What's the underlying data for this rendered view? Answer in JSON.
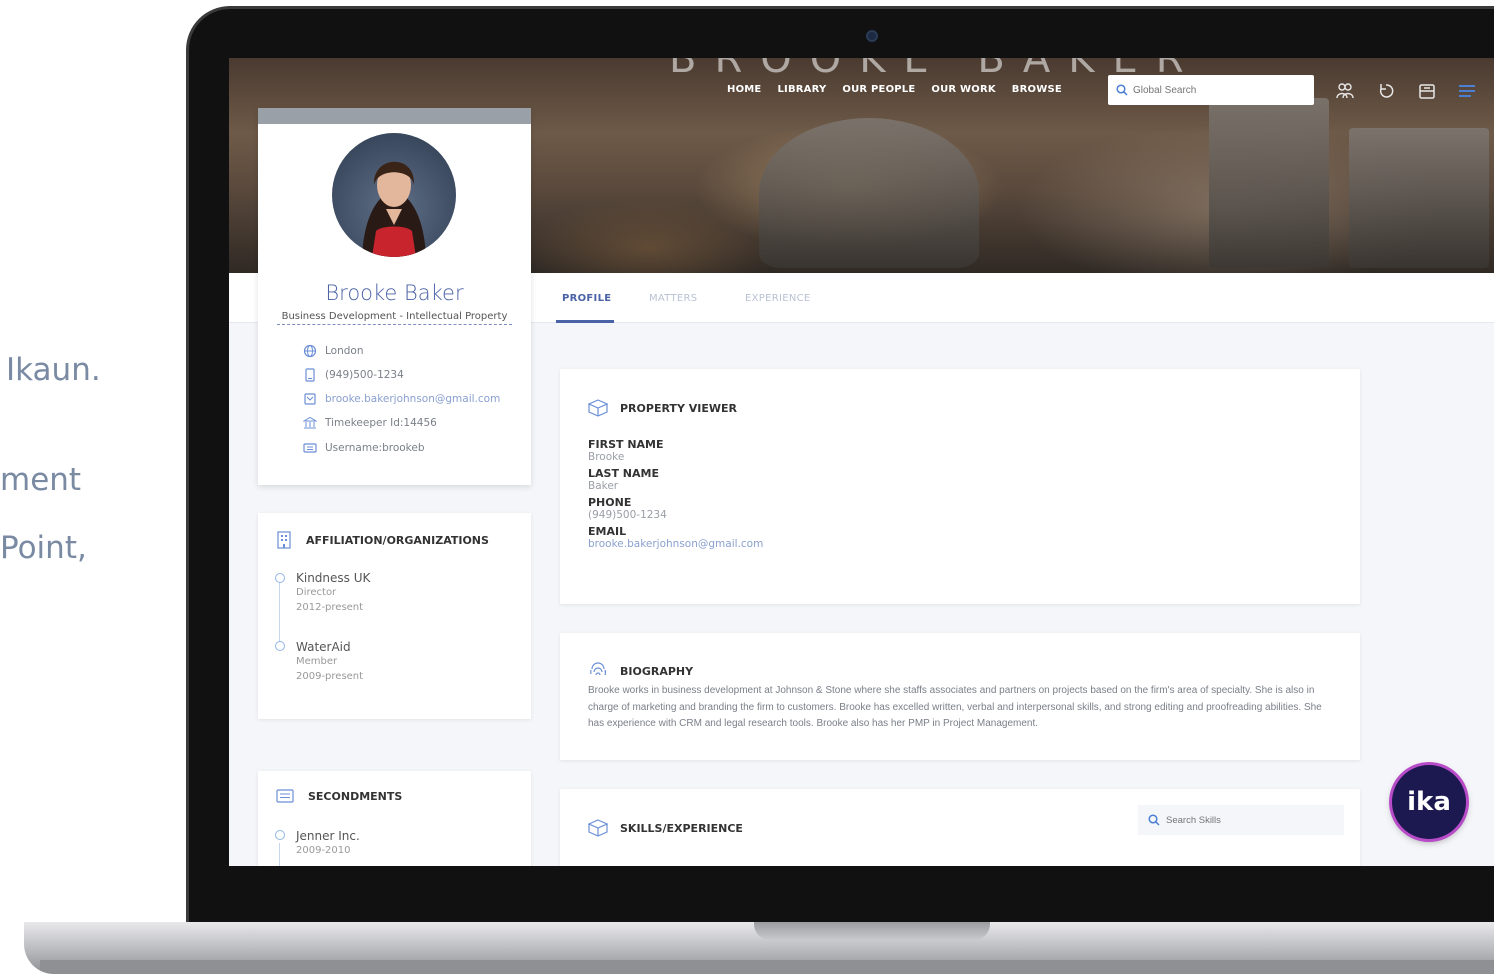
{
  "side_text": [
    "Ikaun.",
    "ment",
    "Point,"
  ],
  "hero": {
    "title": "BROOKE BAKER"
  },
  "nav": {
    "items": [
      "HOME",
      "LIBRARY",
      "OUR PEOPLE",
      "OUR WORK",
      "BROWSE"
    ]
  },
  "search": {
    "placeholder": "Global Search"
  },
  "header_icons": [
    "people-icon",
    "refresh-icon",
    "inbox-icon",
    "menu-icon"
  ],
  "profile": {
    "name": "Brooke Baker",
    "role": "Business Development - Intellectual Property",
    "location": "London",
    "phone": "(949)500-1234",
    "email": "brooke.bakerjohnson@gmail.com",
    "timekeeper": "Timekeeper Id:14456",
    "username": "Username:brookeb"
  },
  "affiliations": {
    "heading": "AFFILIATION/ORGANIZATIONS",
    "items": [
      {
        "name": "Kindness UK",
        "role": "Director",
        "period": "2012-present"
      },
      {
        "name": "WaterAid",
        "role": "Member",
        "period": "2009-present"
      }
    ]
  },
  "secondments": {
    "heading": "SECONDMENTS",
    "items": [
      {
        "name": "Jenner Inc.",
        "period": "2009-2010"
      }
    ]
  },
  "tabs": [
    {
      "label": "PROFILE",
      "active": true
    },
    {
      "label": "MATTERS",
      "active": false
    },
    {
      "label": "EXPERIENCE",
      "active": false
    }
  ],
  "property_viewer": {
    "heading": "PROPERTY VIEWER",
    "fields": [
      {
        "label": "FIRST NAME",
        "value": "Brooke"
      },
      {
        "label": "LAST NAME",
        "value": "Baker"
      },
      {
        "label": "PHONE",
        "value": "(949)500-1234"
      },
      {
        "label": "EMAIL",
        "value": "brooke.bakerjohnson@gmail.com"
      }
    ]
  },
  "biography": {
    "heading": "BIOGRAPHY",
    "text": "Brooke works in business development at Johnson & Stone where she staffs associates and partners on projects based on the firm's area of specialty. She is also in charge of marketing and branding the firm to customers. Brooke has excelled written, verbal and interpersonal skills, and strong editing and proofreading abilities. She has experience with CRM and legal research tools. Brooke also has her PMP in Project Management."
  },
  "skills": {
    "heading": "SKILLS/EXPERIENCE",
    "search_placeholder": "Search Skills"
  },
  "badge": {
    "label": "ika"
  },
  "colors": {
    "accent": "#4a62a6",
    "link": "#8aa0cf",
    "badge_bg": "#1c1850",
    "badge_ring": "#b84cc8"
  }
}
